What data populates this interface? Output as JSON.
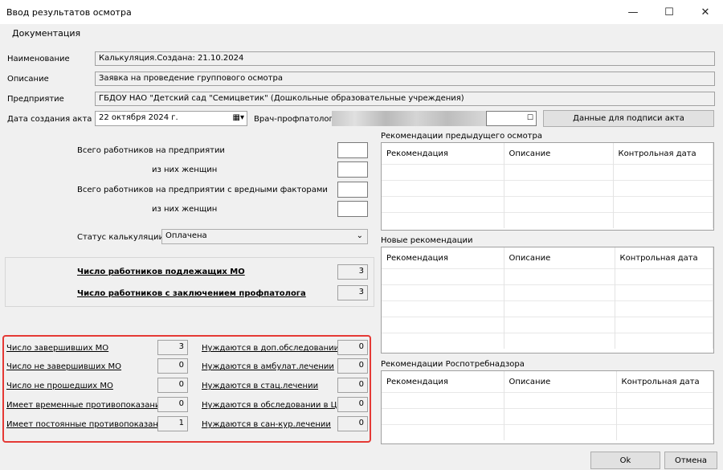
{
  "window": {
    "title": "Ввод результатов осмотра",
    "minimize": "—",
    "maximize": "☐",
    "close": "✕"
  },
  "menu": {
    "documentation": "Документация"
  },
  "form": {
    "name_label": "Наименование",
    "name_value": "Калькуляция.Создана: 21.10.2024",
    "desc_label": "Описание",
    "desc_value": "Заявка на проведение группового осмотра",
    "org_label": "Предприятие",
    "org_value": "ГБДОУ НАО \"Детский сад \"Семицветик\" (Дошкольные образовательные учреждения)",
    "date_label": "Дата создания акта",
    "date_value": "22  октября  2024 г.",
    "doctor_label": "Врач-профпатолог",
    "sign_button": "Данные для подписи акта"
  },
  "counts": {
    "total_workers": "Всего работников на предприятии",
    "of_them_women": "из них женщин",
    "total_harmful": "Всего работников на предприятии с вредными факторами",
    "of_them_women2": "из них женщин",
    "status_label": "Статус калькуляции",
    "status_value": "Оплачена"
  },
  "summary": {
    "subject_label": "Число работников подлежащих МО",
    "subject_value": "3",
    "conclusion_label": "Число работников с заключением профпатолога",
    "conclusion_value": "3"
  },
  "stats_left": [
    {
      "label": "Число завершивших МО",
      "value": "3"
    },
    {
      "label": "Число не завершивших МО",
      "value": "0"
    },
    {
      "label": "Число не прошедших МО",
      "value": "0"
    },
    {
      "label": "Имеет временные противопоказания",
      "value": "0"
    },
    {
      "label": "Имеет постоянные противопоказания",
      "value": "1"
    }
  ],
  "stats_right": [
    {
      "label": "Нуждаются в доп.обследовании",
      "value": "0"
    },
    {
      "label": "Нуждаются в амбулат.лечении",
      "value": "0"
    },
    {
      "label": "Нуждаются в стац.лечении",
      "value": "0"
    },
    {
      "label": "Нуждаются в обследовании в ЦП",
      "value": "0"
    },
    {
      "label": "Нуждаются в сан-кур.лечении",
      "value": "0"
    }
  ],
  "grids": {
    "prev": {
      "title": "Рекомендации предыдущего осмотра",
      "col1": "Рекомендация",
      "col2": "Описание",
      "col3": "Контрольная дата"
    },
    "new": {
      "title": "Новые рекомендации",
      "col1": "Рекомендация",
      "col2": "Описание",
      "col3": "Контрольная дата"
    },
    "rpn": {
      "title": "Рекомендации Роспотребнадзора",
      "col1": "Рекомендация",
      "col2": "Описание",
      "col3": "Контрольная дата"
    }
  },
  "buttons": {
    "ok": "Ok",
    "cancel": "Отмена"
  },
  "colors": {
    "highlight_border": "#e53935"
  }
}
